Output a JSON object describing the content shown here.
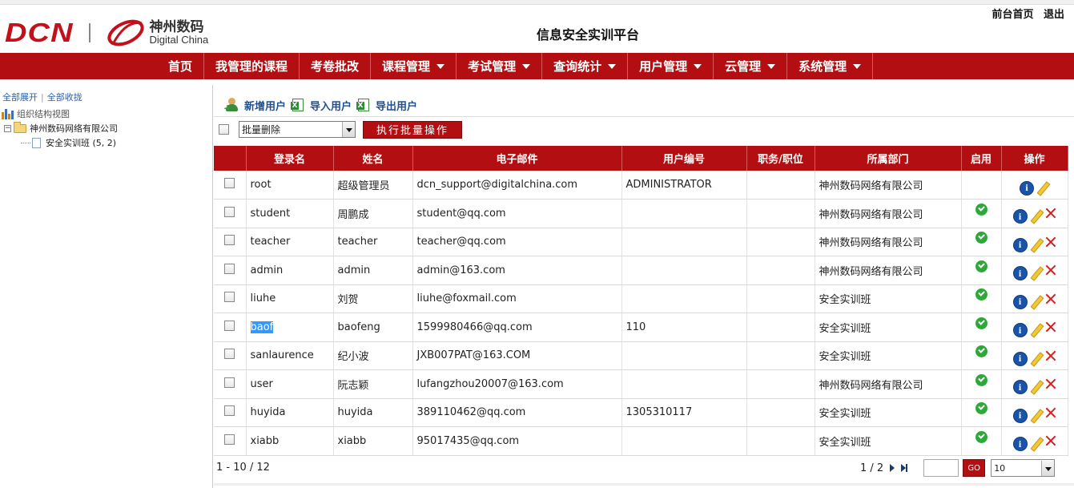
{
  "header": {
    "brand_left": "DCN",
    "brand_cn": "神州数码",
    "brand_en": "Digital China",
    "platform_title": "信息安全实训平台",
    "top_links": [
      "前台首页",
      "退出"
    ]
  },
  "nav": {
    "items": [
      {
        "label": "首页",
        "has_dropdown": false
      },
      {
        "label": "我管理的课程",
        "has_dropdown": false
      },
      {
        "label": "考卷批改",
        "has_dropdown": false
      },
      {
        "label": "课程管理",
        "has_dropdown": true
      },
      {
        "label": "考试管理",
        "has_dropdown": true
      },
      {
        "label": "查询统计",
        "has_dropdown": true
      },
      {
        "label": "用户管理",
        "has_dropdown": true
      },
      {
        "label": "云管理",
        "has_dropdown": true
      },
      {
        "label": "系统管理",
        "has_dropdown": true
      }
    ]
  },
  "tree": {
    "expand_all": "全部展开",
    "collapse_all": "全部收拢",
    "root_label": "组织结构视图",
    "org_label": "神州数码网络有限公司",
    "class_label": "安全实训班 (5, 2)"
  },
  "toolbar": {
    "add_user": "新增用户",
    "import_user": "导入用户",
    "export_user": "导出用户"
  },
  "batch": {
    "selected_option": "批量删除",
    "execute_label": "执行批量操作"
  },
  "table": {
    "columns": [
      "登录名",
      "姓名",
      "电子邮件",
      "用户编号",
      "职务/职位",
      "所属部门",
      "启用",
      "操作"
    ],
    "rows": [
      {
        "login": "root",
        "name": "超级管理员",
        "email": "dcn_support@digitalchina.com",
        "user_no": "ADMINISTRATOR",
        "position": "",
        "dept": "神州数码网络有限公司",
        "enabled": false,
        "deletable": false,
        "selected": false
      },
      {
        "login": "student",
        "name": "周鹏成",
        "email": "student@qq.com",
        "user_no": "",
        "position": "",
        "dept": "神州数码网络有限公司",
        "enabled": true,
        "deletable": true,
        "selected": false
      },
      {
        "login": "teacher",
        "name": "teacher",
        "email": "teacher@qq.com",
        "user_no": "",
        "position": "",
        "dept": "神州数码网络有限公司",
        "enabled": true,
        "deletable": true,
        "selected": false
      },
      {
        "login": "admin",
        "name": "admin",
        "email": "admin@163.com",
        "user_no": "",
        "position": "",
        "dept": "神州数码网络有限公司",
        "enabled": true,
        "deletable": true,
        "selected": false
      },
      {
        "login": "liuhe",
        "name": "刘贺",
        "email": "liuhe@foxmail.com",
        "user_no": "",
        "position": "",
        "dept": "安全实训班",
        "enabled": true,
        "deletable": true,
        "selected": false
      },
      {
        "login": "baof",
        "name": "baofeng",
        "email": "1599980466@qq.com",
        "user_no": "110",
        "position": "",
        "dept": "安全实训班",
        "enabled": true,
        "deletable": true,
        "selected": true
      },
      {
        "login": "sanlaurence",
        "name": "纪小波",
        "email": "JXB007PAT@163.COM",
        "user_no": "",
        "position": "",
        "dept": "安全实训班",
        "enabled": true,
        "deletable": true,
        "selected": false
      },
      {
        "login": "user",
        "name": "阮志颖",
        "email": "lufangzhou20007@163.com",
        "user_no": "",
        "position": "",
        "dept": "神州数码网络有限公司",
        "enabled": true,
        "deletable": true,
        "selected": false
      },
      {
        "login": "huyida",
        "name": "huyida",
        "email": "389110462@qq.com",
        "user_no": "1305310117",
        "position": "",
        "dept": "安全实训班",
        "enabled": true,
        "deletable": true,
        "selected": false
      },
      {
        "login": "xiabb",
        "name": "xiabb",
        "email": "95017435@qq.com",
        "user_no": "",
        "position": "",
        "dept": "安全实训班",
        "enabled": true,
        "deletable": true,
        "selected": false
      }
    ]
  },
  "pager": {
    "range": "1 - 10 / 12",
    "page_info": "1 / 2",
    "go_label": "GO",
    "page_size": "10"
  },
  "icons": {
    "info": "info-icon",
    "edit": "pencil-icon",
    "delete": "delete-x-icon",
    "enabled": "green-check-icon"
  },
  "colors": {
    "brand_red": "#b30f12",
    "link_blue": "#1f4f8f",
    "check_green": "#2fa83a"
  }
}
